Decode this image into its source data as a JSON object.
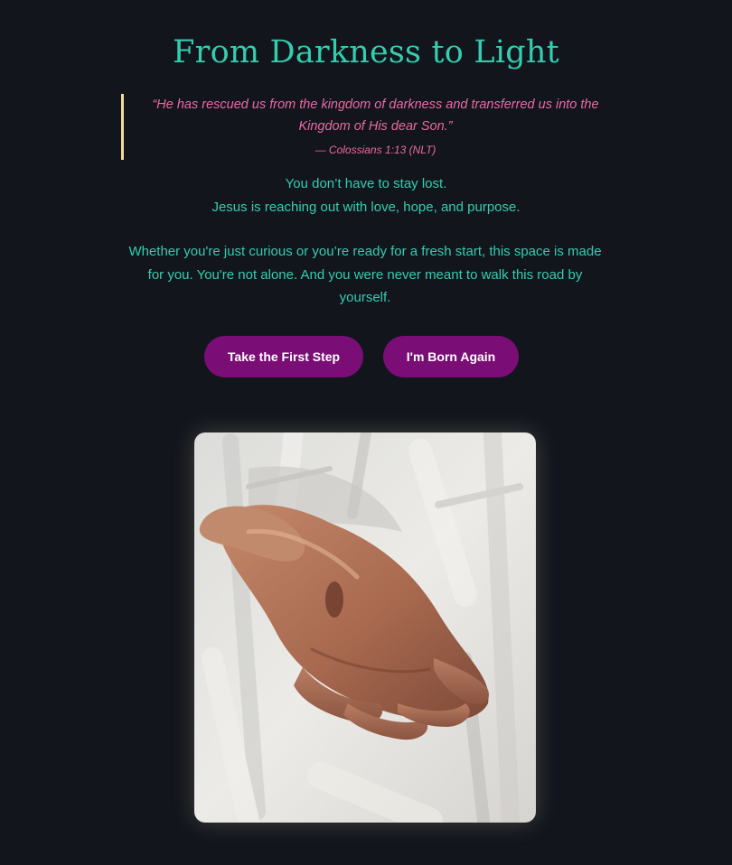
{
  "hero": {
    "title": "From Darkness to Light"
  },
  "scripture": {
    "quote": "“He has rescued us from the kingdom of darkness and transferred us into the Kingdom of His dear Son.”",
    "citation": "— Colossians 1:13 (NLT)"
  },
  "intro": {
    "line_1": "You don’t have to stay lost.",
    "line_2": "Jesus is reaching out with love, hope, and purpose.",
    "paragraph": "Whether you're just curious or you’re ready for a fresh start, this space is made for you. You're not alone. And you were never meant to walk this road by yourself."
  },
  "actions": {
    "first_step_label": "Take the First Step",
    "born_again_label": "I'm Born Again"
  },
  "colors": {
    "background": "#12151c",
    "title": "#34cdb0",
    "quote": "#e96aa6",
    "quote_border": "#f1dc9b",
    "button": "#7a0e76"
  }
}
